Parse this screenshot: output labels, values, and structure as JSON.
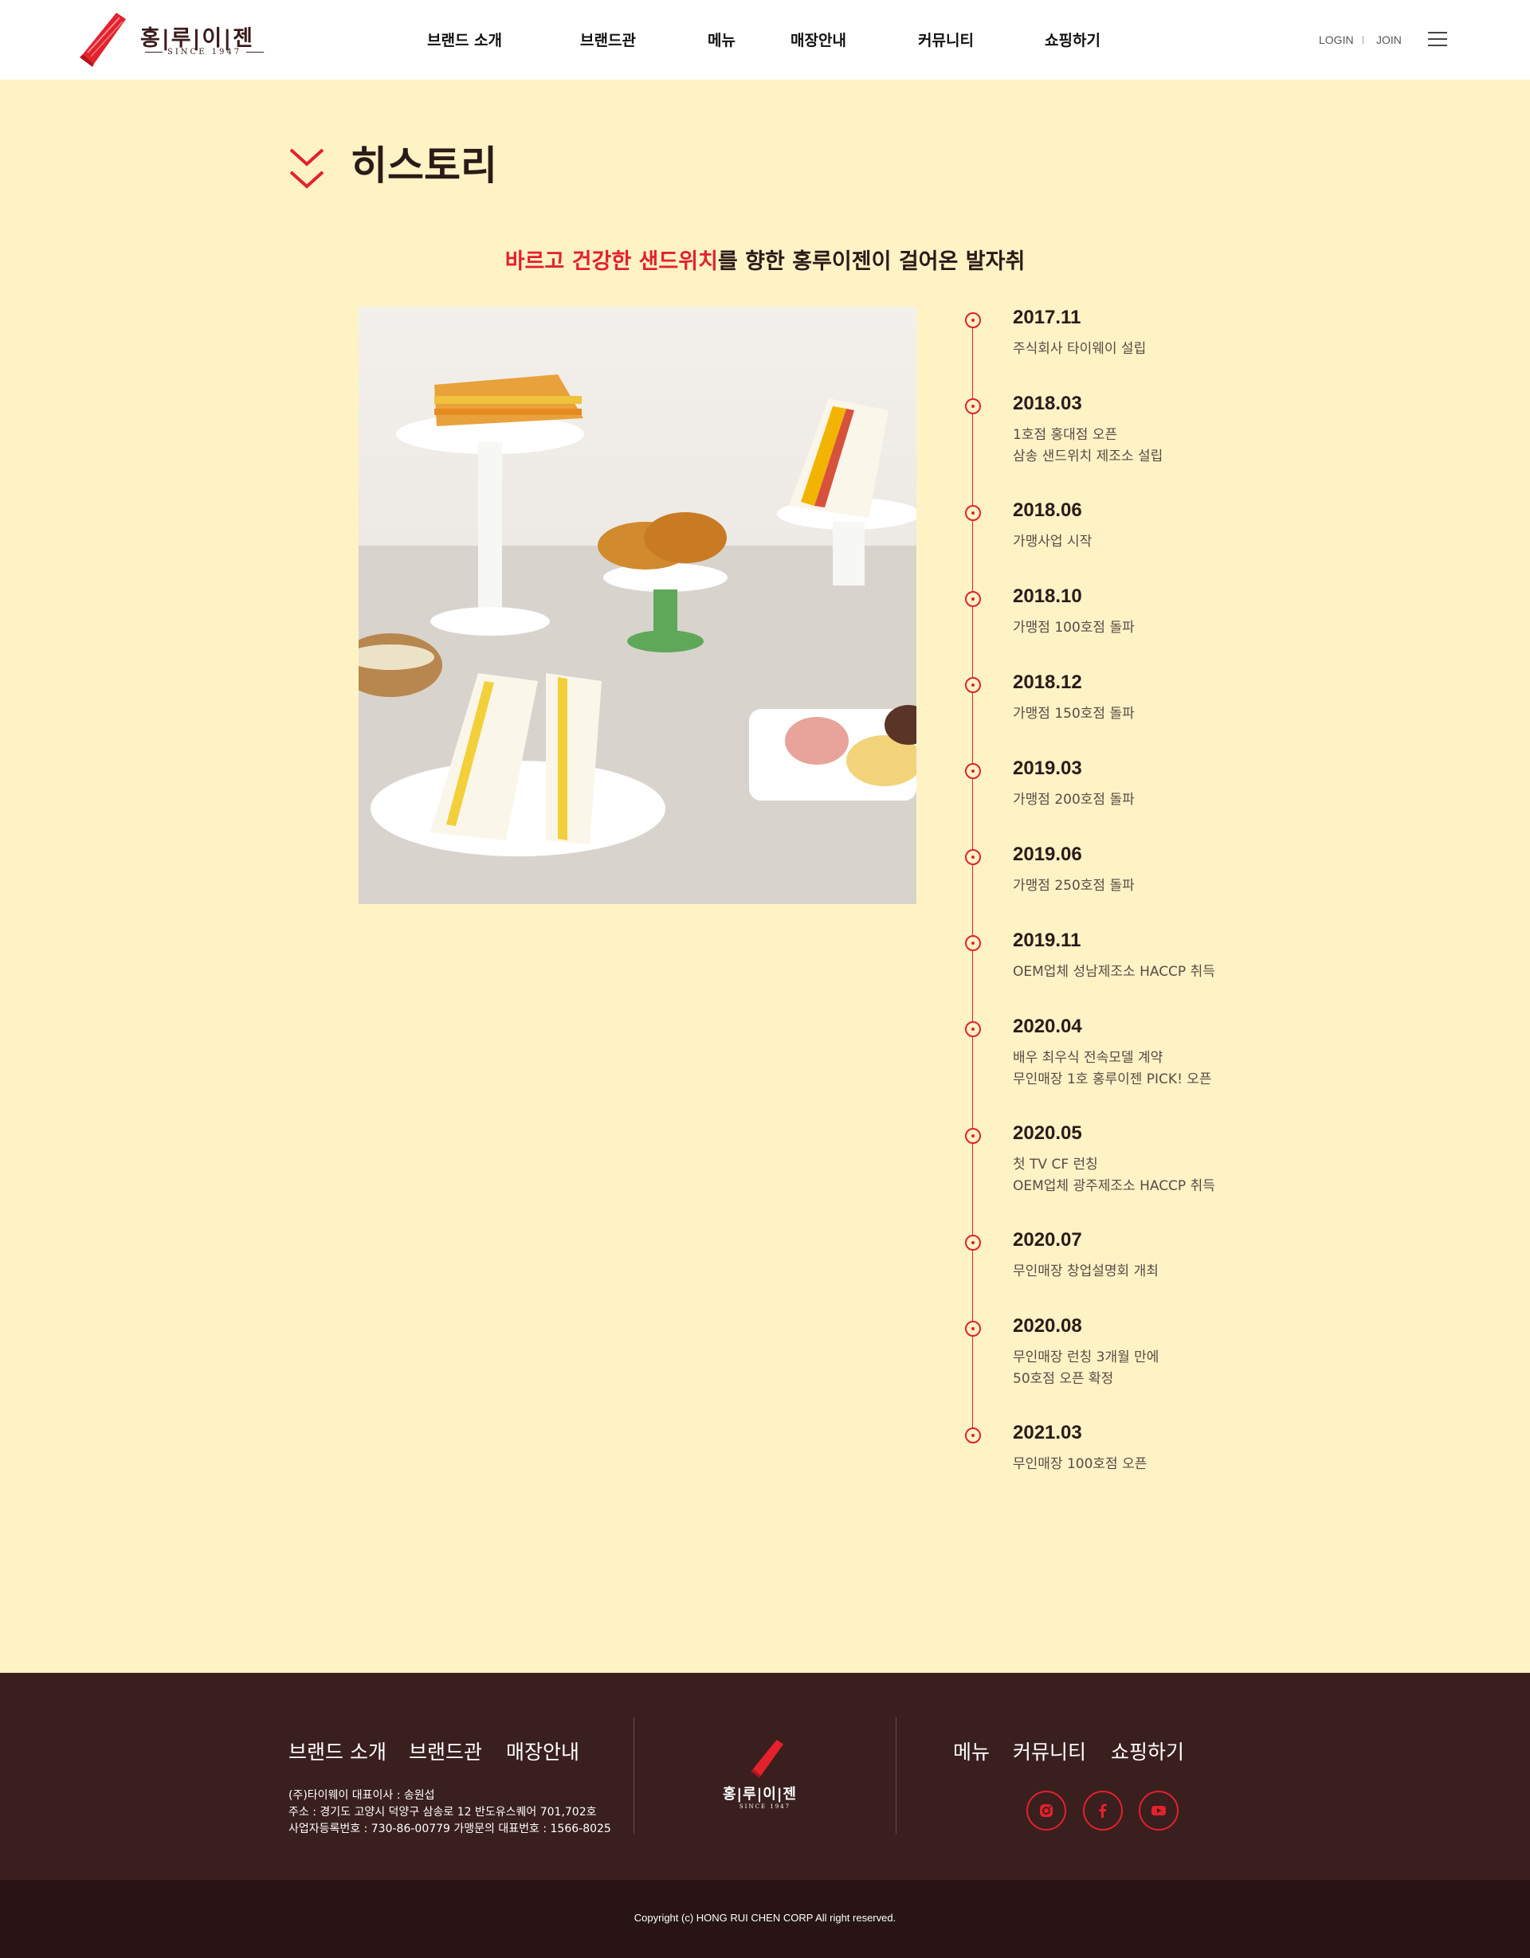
{
  "header": {
    "logo_text": "홍|루|이|젠",
    "logo_since": "SINCE 1947",
    "nav": [
      "브랜드 소개",
      "브랜드관",
      "메뉴",
      "매장안내",
      "커뮤니티",
      "쇼핑하기"
    ],
    "login": "LOGIN",
    "join": "JOIN"
  },
  "section": {
    "title": "히스토리",
    "subtitle_highlight": "바르고 건강한 샌드위치",
    "subtitle_rest": "를 향한 홍루이젠이 걸어온 발자취"
  },
  "timeline": [
    {
      "year": "2017.11",
      "lines": [
        "주식회사 타이웨이 설립"
      ]
    },
    {
      "year": "2018.03",
      "lines": [
        "1호점 홍대점 오픈",
        "삼송 샌드위치 제조소 설립"
      ]
    },
    {
      "year": "2018.06",
      "lines": [
        "가맹사업 시작"
      ]
    },
    {
      "year": "2018.10",
      "lines": [
        "가맹점 100호점 돌파"
      ]
    },
    {
      "year": "2018.12",
      "lines": [
        "가맹점 150호점 돌파"
      ]
    },
    {
      "year": "2019.03",
      "lines": [
        "가맹점 200호점 돌파"
      ]
    },
    {
      "year": "2019.06",
      "lines": [
        "가맹점 250호점 돌파"
      ]
    },
    {
      "year": "2019.11",
      "lines": [
        "OEM업체 성남제조소 HACCP 취득"
      ]
    },
    {
      "year": "2020.04",
      "lines": [
        "배우 최우식 전속모델 계약",
        "무인매장 1호 홍루이젠 PICK! 오픈"
      ]
    },
    {
      "year": "2020.05",
      "lines": [
        "첫 TV CF 런칭",
        "OEM업체 광주제조소 HACCP 취득"
      ]
    },
    {
      "year": "2020.07",
      "lines": [
        "무인매장 창업설명회 개최"
      ]
    },
    {
      "year": "2020.08",
      "lines": [
        "무인매장 런칭 3개월 만에",
        "50호점 오픈 확정"
      ]
    },
    {
      "year": "2021.03",
      "lines": [
        "무인매장 100호점 오픈"
      ]
    }
  ],
  "footer": {
    "links_left": [
      "브랜드 소개",
      "브랜드관",
      "매장안내"
    ],
    "links_right": [
      "메뉴",
      "커뮤니티",
      "쇼핑하기"
    ],
    "info": [
      "(주)타이웨이 대표이사 : 송원섭",
      "주소 : 경기도 고양시 덕양구 삼송로 12 반도유스퀘어 701,702호",
      "사업자등록번호 : 730-86-00779 가맹문의 대표번호 : 1566-8025"
    ],
    "logo_text": "홍|루|이|젠",
    "logo_since": "SINCE 1947",
    "sns": [
      "instagram-icon",
      "facebook-icon",
      "youtube-icon"
    ],
    "copyright": "Copyright (c) HONG RUI CHEN CORP All right reserved."
  },
  "colors": {
    "accent": "#e4212c",
    "background": "#fff3c6",
    "footer": "#3a1f1f",
    "copyright_bar": "#281414"
  }
}
